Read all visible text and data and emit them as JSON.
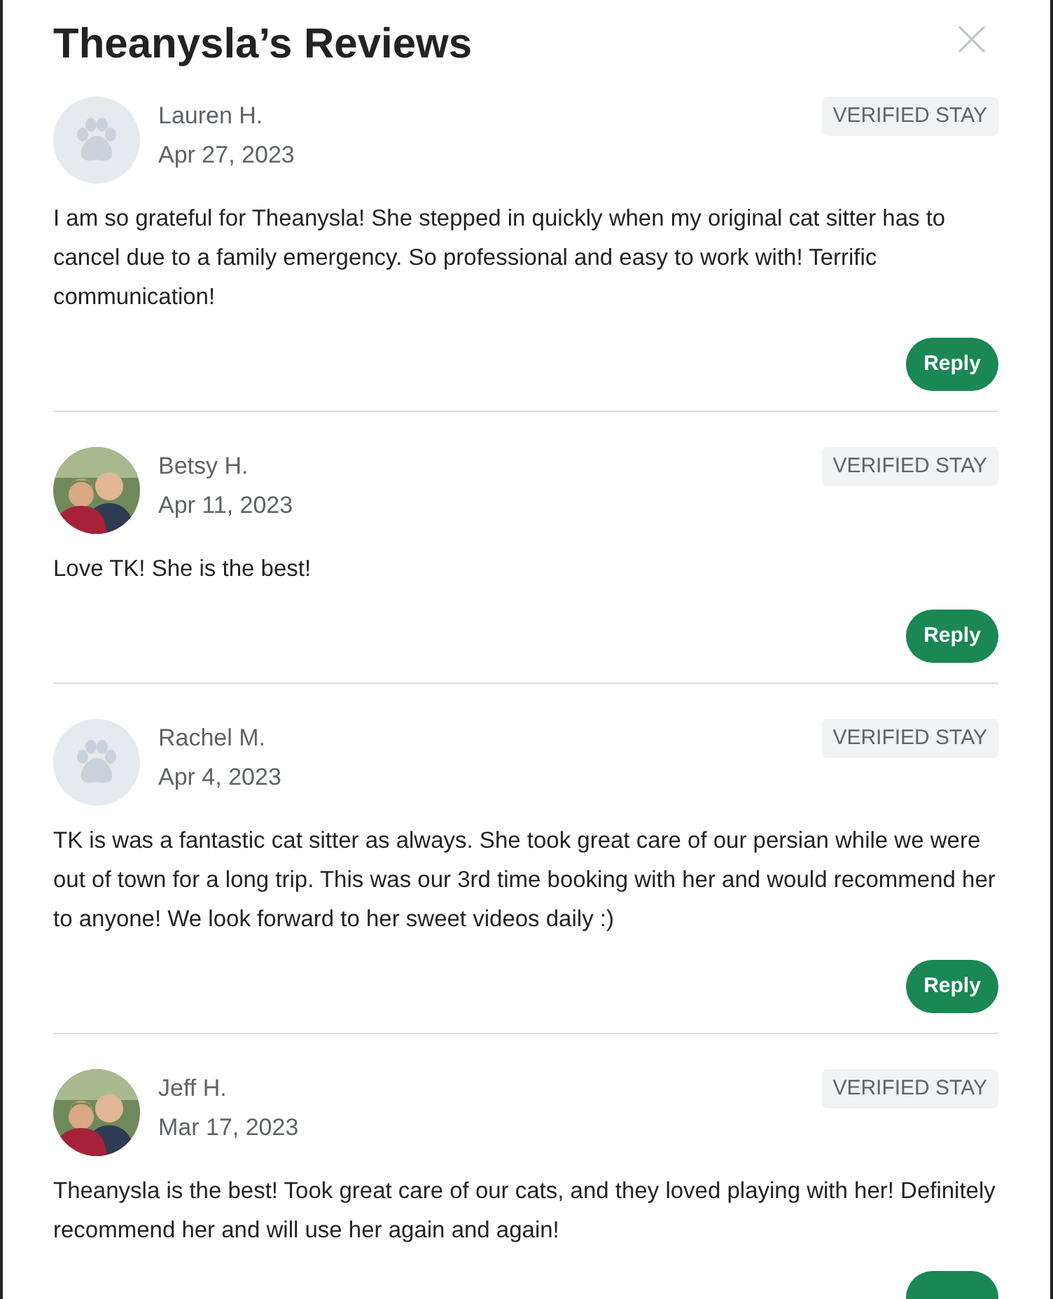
{
  "title": "Theanysla’s Reviews",
  "reviews": [
    {
      "name": "Lauren H.",
      "date": "Apr 27, 2023",
      "badge": "VERIFIED STAY",
      "avatar": {
        "kind": "placeholder"
      },
      "text": "I am so grateful for Theanysla! She stepped in quickly when my original cat sitter has to cancel due to a family emergency. So professional and easy to work with! Terrific communication!",
      "reply": "Reply"
    },
    {
      "name": "Betsy H.",
      "date": "Apr 11, 2023",
      "badge": "VERIFIED STAY",
      "text": "Love TK! She is the best!",
      "reply": "Reply"
    },
    {
      "name": "Rachel M.",
      "date": "Apr 4, 2023",
      "badge": "VERIFIED STAY",
      "avatar": {
        "kind": "placeholder"
      },
      "text": "TK is was a fantastic cat sitter as always. She took great care of our persian while we were out of town for a long trip. This was our 3rd time booking with her and would recommend her to anyone! We look forward to her sweet videos daily :)",
      "reply": "Reply"
    },
    {
      "name": "Jeff H.",
      "date": "Mar 17, 2023",
      "badge": "VERIFIED STAY",
      "text": "Theanysla is the best! Took great care of our cats, and they loved playing with her! Definitely recommend her and will use her again and again!"
    }
  ]
}
